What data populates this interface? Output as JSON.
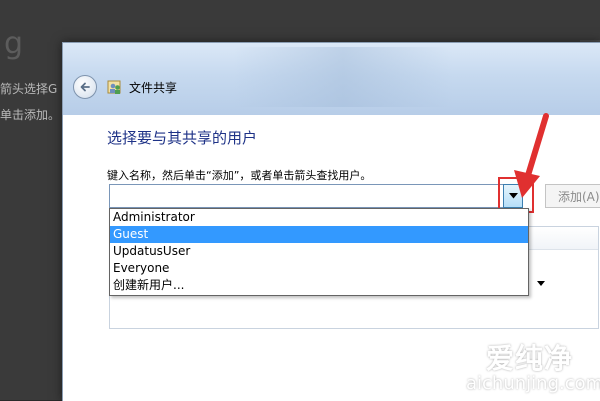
{
  "background": {
    "big_letter": "g",
    "line1": "箭头选择G",
    "line2": "单击添加。"
  },
  "window": {
    "title": "文件共享",
    "back_icon": "back-arrow-icon",
    "title_icon": "file-share-icon"
  },
  "main": {
    "heading": "选择要与其共享的用户",
    "instruction": "键入名称，然后单击“添加”，或者单击箭头查找用户。",
    "name_input": {
      "value": "",
      "placeholder": ""
    },
    "add_button_label": "添加(A)"
  },
  "dropdown": {
    "options": [
      "Administrator",
      "Guest",
      "UpdatusUser",
      "Everyone",
      "创建新用户..."
    ],
    "selected": "Guest"
  },
  "annotation": {
    "color": "#e03030"
  },
  "watermark": {
    "name": "爱纯净",
    "url": "aichunjing.com"
  },
  "colors": {
    "heading": "#1e3287",
    "selection": "#3399ff",
    "highlight": "#e03030"
  }
}
